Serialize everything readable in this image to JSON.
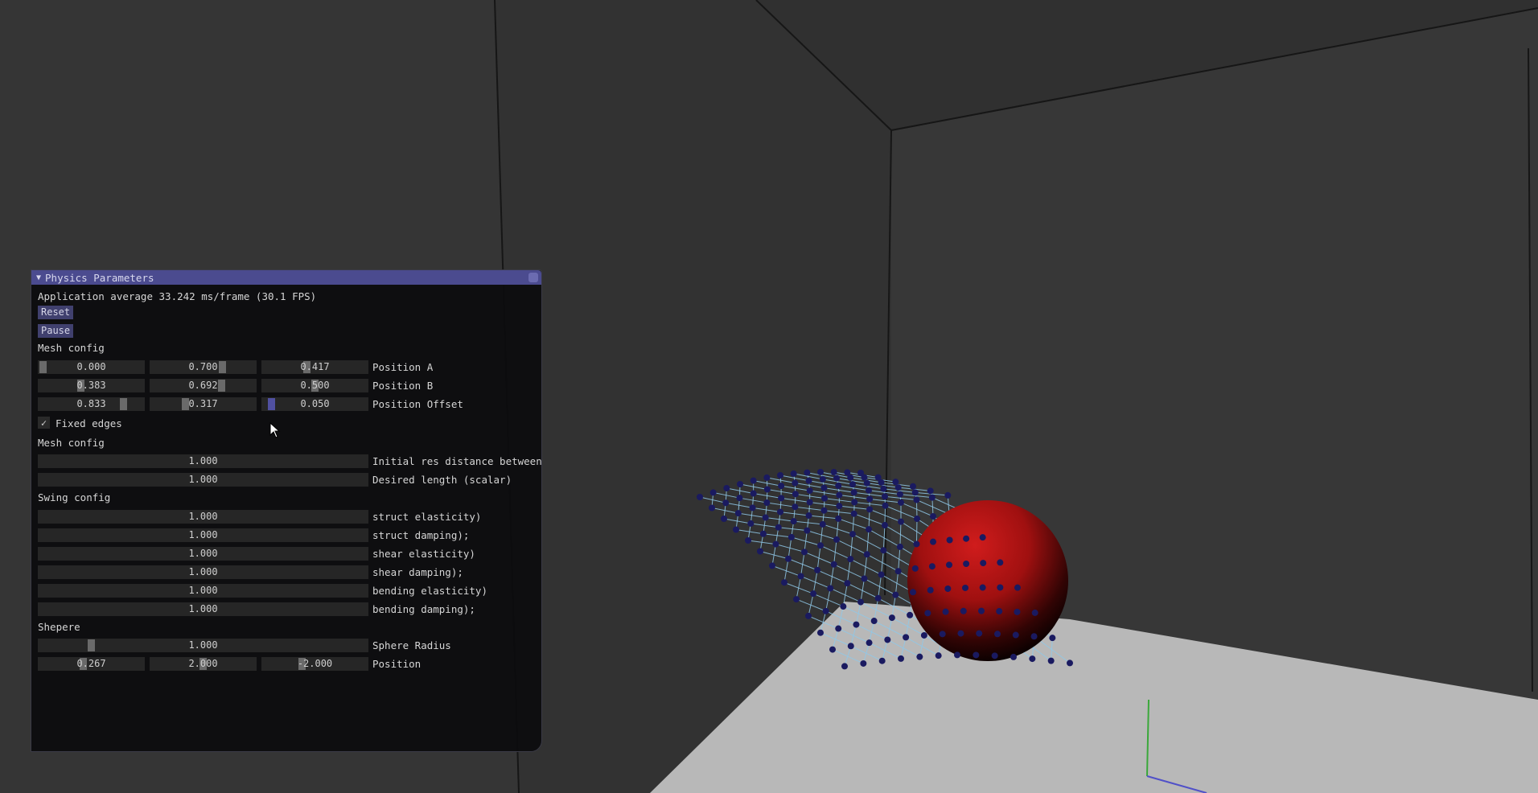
{
  "panel": {
    "title": "Physics Parameters",
    "fps_text": "Application average 33.242 ms/frame (30.1 FPS)",
    "reset_label": "Reset",
    "pause_label": "Pause",
    "section_mesh_1": "Mesh config",
    "position_a": {
      "values": [
        "0.000",
        "0.700",
        "0.417"
      ],
      "label": "Position A"
    },
    "position_b": {
      "values": [
        "0.383",
        "0.692",
        "0.500"
      ],
      "label": "Position B"
    },
    "position_offset": {
      "values": [
        "0.833",
        "0.317",
        "0.050"
      ],
      "label": "Position Offset"
    },
    "fixed_edges": {
      "label": "Fixed edges",
      "checked": true
    },
    "section_mesh_2": "Mesh config",
    "initial_res": {
      "value": "1.000",
      "label": "Initial res distance between"
    },
    "desired_length": {
      "value": "1.000",
      "label": "Desired length (scalar)"
    },
    "section_swing": "Swing config",
    "struct_elasticity": {
      "value": "1.000",
      "label": "struct elasticity)"
    },
    "struct_damping": {
      "value": "1.000",
      "label": "struct damping);"
    },
    "shear_elasticity": {
      "value": "1.000",
      "label": "shear elasticity)"
    },
    "shear_damping": {
      "value": "1.000",
      "label": "shear damping);"
    },
    "bending_elasticity": {
      "value": "1.000",
      "label": "bending elasticity)"
    },
    "bending_damping": {
      "value": "1.000",
      "label": "bending damping);"
    },
    "section_sphere": "Shepere",
    "sphere_radius": {
      "value": "1.000",
      "label": "Sphere Radius"
    },
    "sphere_position": {
      "values": [
        "0.267",
        "2.000",
        "-2.000"
      ],
      "label": "Position"
    }
  },
  "colors": {
    "background": "#353535",
    "floor": "#b8b8b8",
    "sphere": "#c41a1a",
    "cloth_lines": "#8fc8e8",
    "cloth_nodes": "#1a1a60",
    "title_bar": "#4b4b8f"
  },
  "icons": [
    "collapse-triangle-icon",
    "checkmark-icon",
    "mouse-cursor-icon"
  ]
}
